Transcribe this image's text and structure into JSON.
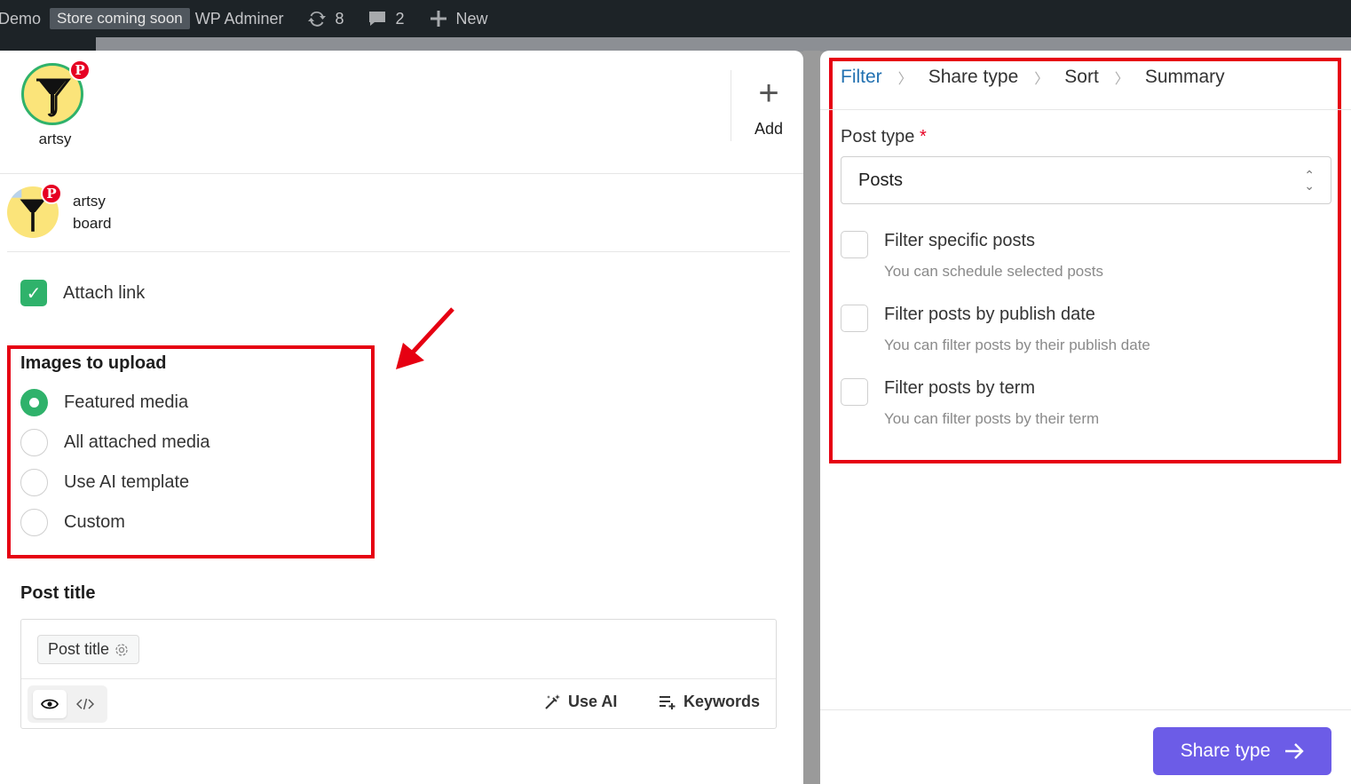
{
  "adminbar": {
    "site": "Demo",
    "store_badge": "Store coming soon",
    "adminer": "WP Adminer",
    "updates_count": "8",
    "comments_count": "2",
    "new_label": "New"
  },
  "left": {
    "account_name": "artsy",
    "pin_glyph": "P",
    "add_label": "Add",
    "board_name": "artsy",
    "board_sub": "board",
    "attach_link": "Attach link",
    "images_title": "Images to upload",
    "image_options": [
      {
        "label": "Featured media",
        "selected": true
      },
      {
        "label": "All attached media",
        "selected": false
      },
      {
        "label": "Use AI template",
        "selected": false
      },
      {
        "label": "Custom",
        "selected": false
      }
    ],
    "post_title_label": "Post title",
    "post_title_chip": "Post title",
    "use_ai": "Use AI",
    "keywords": "Keywords"
  },
  "right": {
    "steps": [
      "Filter",
      "Share type",
      "Sort",
      "Summary"
    ],
    "active_step": "Filter",
    "post_type_label": "Post type",
    "required_mark": "*",
    "post_type_value": "Posts",
    "filters": [
      {
        "label": "Filter specific posts",
        "desc": "You can schedule selected posts"
      },
      {
        "label": "Filter posts by publish date",
        "desc": "You can filter posts by their publish date"
      },
      {
        "label": "Filter posts by term",
        "desc": "You can filter posts by their term"
      }
    ],
    "share_button": "Share type"
  },
  "colors": {
    "accent_green": "#2fb26b",
    "accent_purple": "#6c5ce7",
    "link_blue": "#2271b1",
    "annotation_red": "#e60012",
    "pinterest_red": "#e60023"
  }
}
